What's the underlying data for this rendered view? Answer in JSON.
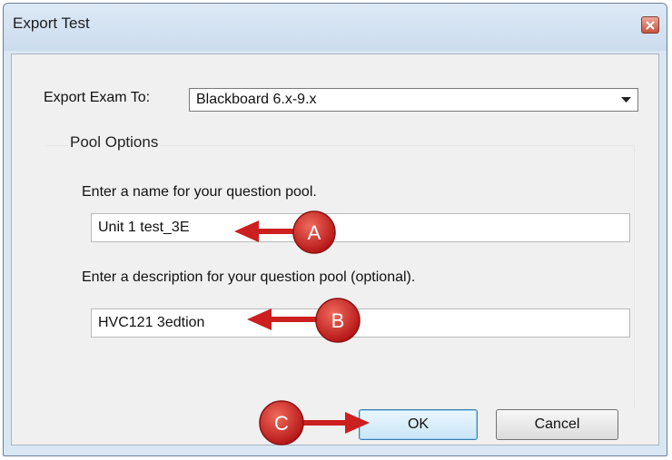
{
  "window": {
    "title": "Export Test"
  },
  "export": {
    "label": "Export Exam To:",
    "selected": "Blackboard 6.x-9.x"
  },
  "pool_options": {
    "title": "Pool Options",
    "name_label": "Enter a name for your question pool.",
    "name_value": "Unit 1 test_3E",
    "description_label": "Enter a description for your question pool (optional).",
    "description_value": "HVC121 3edtion"
  },
  "buttons": {
    "ok": "OK",
    "cancel": "Cancel"
  },
  "annotations": {
    "a": "A",
    "b": "B",
    "c": "C",
    "color": "#cc1f1f"
  }
}
